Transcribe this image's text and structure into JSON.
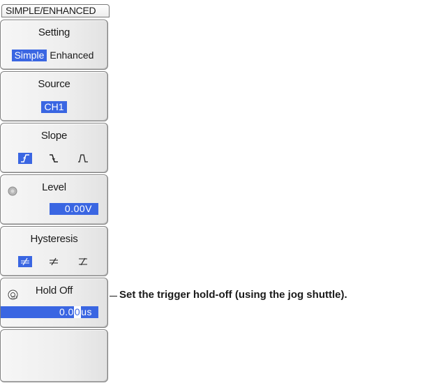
{
  "menu": {
    "header": "SIMPLE/ENHANCED",
    "setting": {
      "title": "Setting",
      "options": [
        "Simple",
        "Enhanced"
      ],
      "selected": "Simple"
    },
    "source": {
      "title": "Source",
      "value": "CH1"
    },
    "slope": {
      "title": "Slope",
      "options": [
        "rising-edge-icon",
        "falling-edge-icon",
        "both-edges-icon"
      ],
      "selected": "rising-edge-icon"
    },
    "level": {
      "title": "Level",
      "value": "0.00V",
      "icon": "jog-knob-icon"
    },
    "hysteresis": {
      "title": "Hysteresis",
      "options": [
        "hysteresis-low-icon",
        "hysteresis-mid-icon",
        "hysteresis-high-icon"
      ],
      "selected": "hysteresis-low-icon"
    },
    "holdoff": {
      "title": "Hold Off",
      "value_prefix": "0.0",
      "value_cursor": "0",
      "value_unit": "us",
      "icon": "jog-shuttle-icon"
    }
  },
  "callout": {
    "text": "Set the trigger hold-off (using the jog shuttle)."
  },
  "colors": {
    "accent": "#3a66e2",
    "panel": "#eeeeee",
    "border": "#808080"
  }
}
